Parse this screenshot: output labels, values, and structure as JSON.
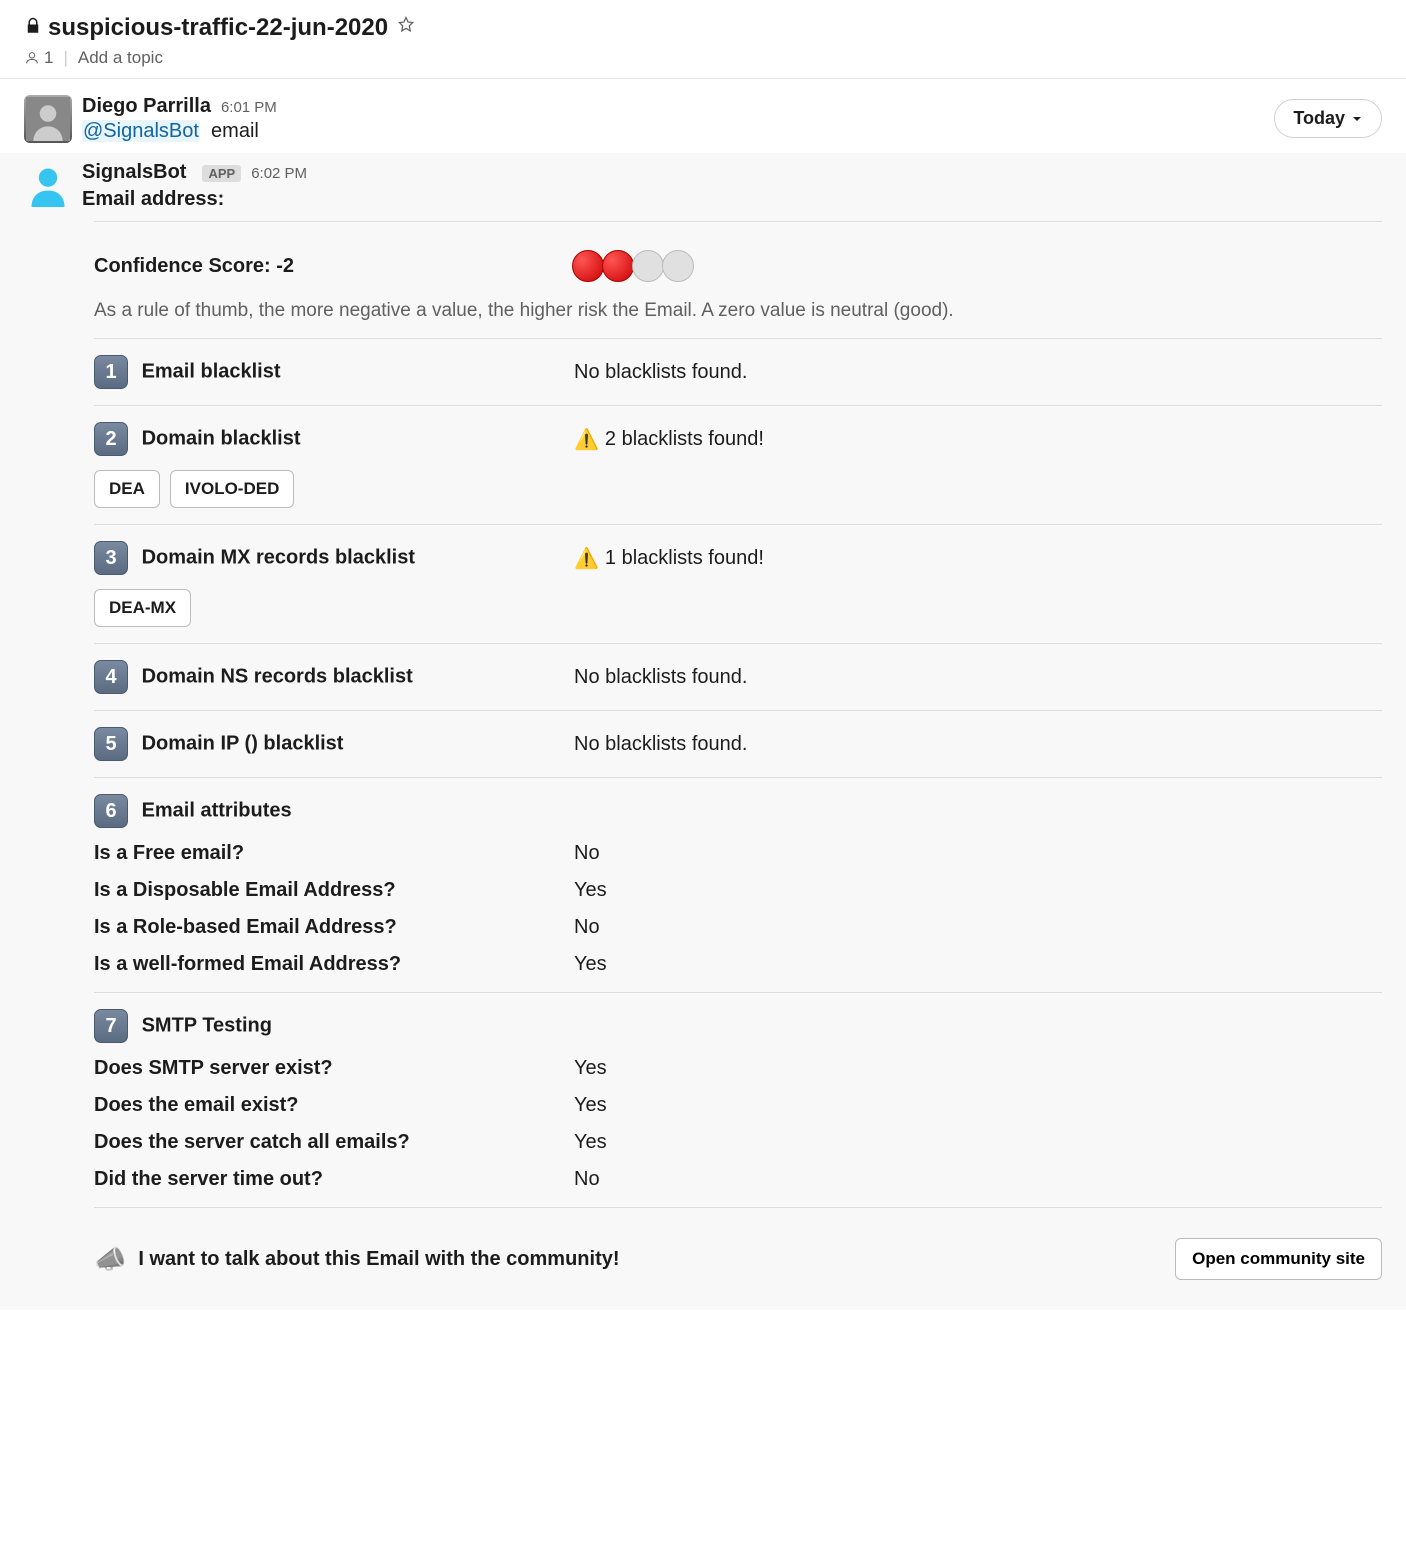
{
  "header": {
    "channel_name": "suspicious-traffic-22-jun-2020",
    "member_count": "1",
    "add_topic": "Add a topic"
  },
  "today_label": "Today",
  "msg1": {
    "author": "Diego Parrilla",
    "time": "6:01 PM",
    "mention": "@SignalsBot",
    "text_after": "email"
  },
  "msg2": {
    "author": "SignalsBot",
    "badge": "APP",
    "time": "6:02 PM",
    "title": "Email address:"
  },
  "confidence": {
    "label": "Confidence Score: -2",
    "hint": "As a rule of thumb, the more negative a value, the higher risk the Email. A zero value is neutral (good)."
  },
  "sections": {
    "s1": {
      "num": "1",
      "title": "Email blacklist",
      "value": "No blacklists found."
    },
    "s2": {
      "num": "2",
      "title": "Domain blacklist",
      "value": "2 blacklists found!",
      "warn": "⚠️",
      "chips": [
        "DEA",
        "IVOLO-DED"
      ]
    },
    "s3": {
      "num": "3",
      "title": "Domain MX records blacklist",
      "value": "1 blacklists found!",
      "warn": "⚠️",
      "chips": [
        "DEA-MX"
      ]
    },
    "s4": {
      "num": "4",
      "title": "Domain NS records blacklist",
      "value": "No blacklists found."
    },
    "s5": {
      "num": "5",
      "title": "Domain IP () blacklist",
      "value": "No blacklists found."
    },
    "s6": {
      "num": "6",
      "title": "Email attributes"
    },
    "s7": {
      "num": "7",
      "title": "SMTP Testing"
    }
  },
  "attrs": {
    "a1": {
      "k": "Is a Free email?",
      "v": "No"
    },
    "a2": {
      "k": "Is a Disposable Email Address?",
      "v": "Yes"
    },
    "a3": {
      "k": "Is a Role-based Email Address?",
      "v": "No"
    },
    "a4": {
      "k": "Is a well-formed Email Address?",
      "v": "Yes"
    }
  },
  "smtp": {
    "t1": {
      "k": "Does SMTP server exist?",
      "v": "Yes"
    },
    "t2": {
      "k": "Does the email exist?",
      "v": "Yes"
    },
    "t3": {
      "k": "Does the server catch all emails?",
      "v": "Yes"
    },
    "t4": {
      "k": "Did the server time out?",
      "v": "No"
    }
  },
  "footer": {
    "emoji": "📣",
    "text": "I want to talk about this Email with the community!",
    "button": "Open community site"
  }
}
